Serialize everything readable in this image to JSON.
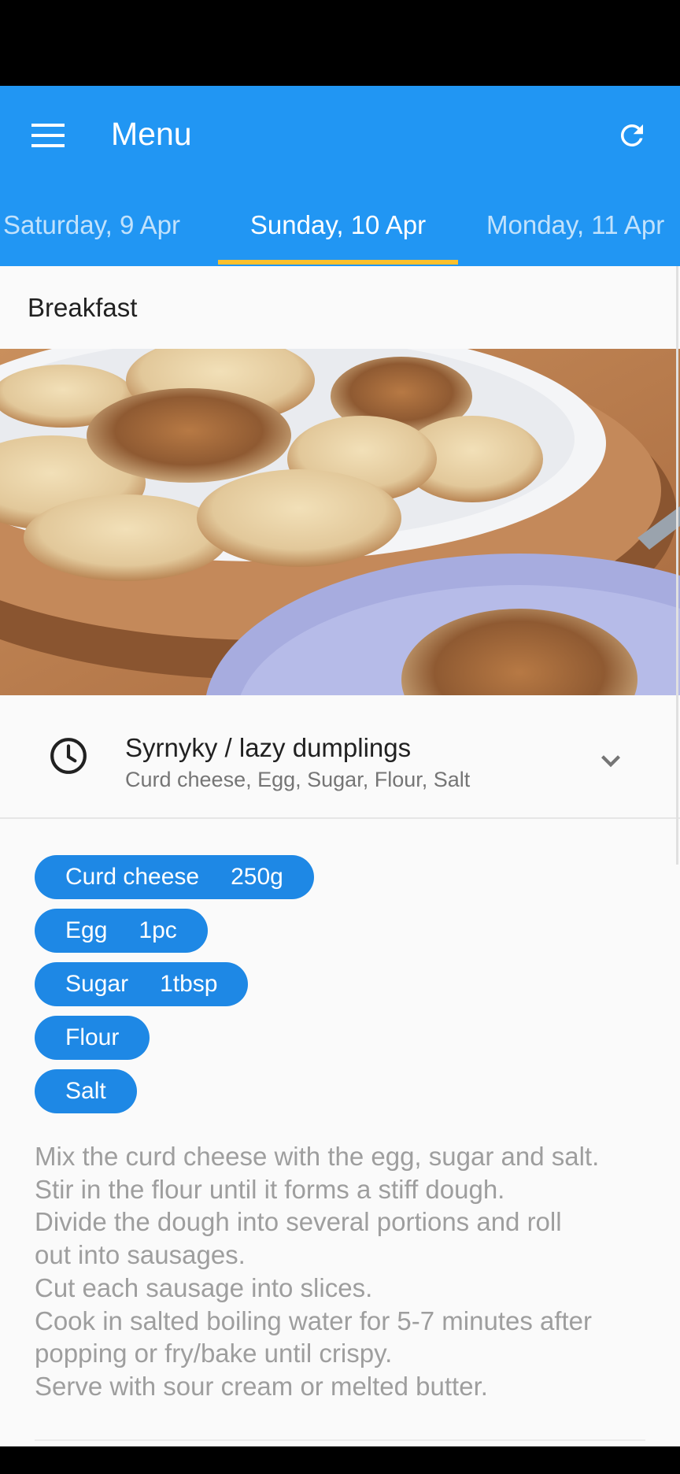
{
  "app_bar": {
    "title": "Menu",
    "color": "#2196f3",
    "menu_icon": "hamburger-menu-icon",
    "refresh_icon": "refresh-icon"
  },
  "tabs": [
    {
      "label": "Saturday, 9 Apr"
    },
    {
      "label": "Sunday, 10 Apr",
      "selected": true
    },
    {
      "label": "Monday, 11 Apr"
    }
  ],
  "tab_indicator_color": "#fbc02d",
  "meal": {
    "label": "Breakfast",
    "dish": {
      "name": "Syrnyky / lazy dumplings",
      "ingredients_summary": "Curd cheese, Egg, Sugar, Flour, Salt",
      "icon": "clock-icon",
      "expand_icon": "chevron-down-icon"
    },
    "ingredients": [
      {
        "name": "Curd cheese",
        "qty": "250g"
      },
      {
        "name": "Egg",
        "qty": "1pc"
      },
      {
        "name": "Sugar",
        "qty": "1tbsp"
      },
      {
        "name": "Flour",
        "qty": ""
      },
      {
        "name": "Salt",
        "qty": ""
      }
    ],
    "chip_color": "#1e88e5",
    "instructions": [
      "Mix the curd cheese with the egg, sugar and salt.",
      "Stir in the flour until it forms a stiff dough.",
      "Divide the dough into several portions and roll",
      "out into sausages.",
      "Cut each sausage into slices.",
      "Cook in salted boiling water for 5-7 minutes after",
      "popping or fry/bake until crispy.",
      "Serve with sour cream or melted butter."
    ]
  }
}
